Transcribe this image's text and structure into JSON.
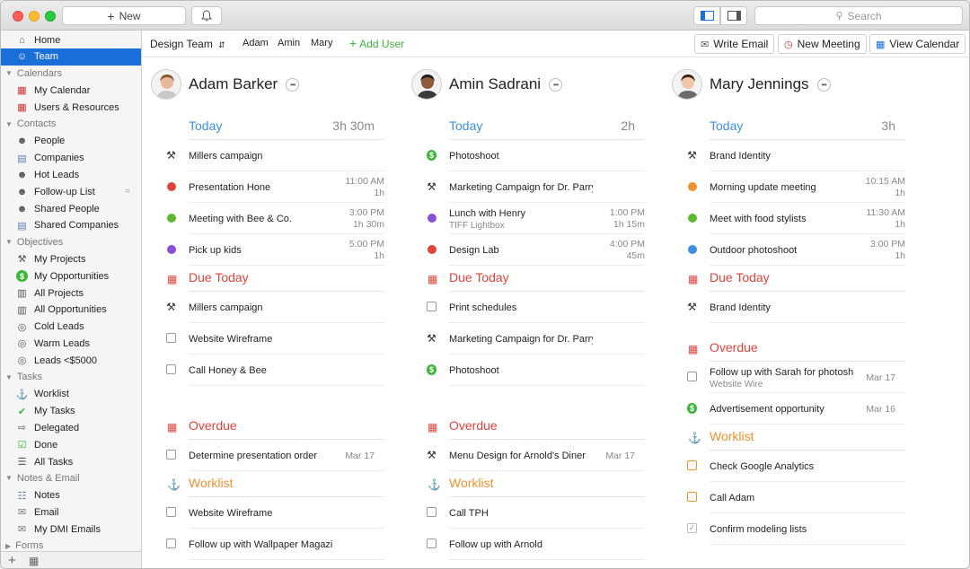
{
  "toolbar": {
    "new_label": "New",
    "search_placeholder": "Search"
  },
  "sidebar": {
    "top": [
      {
        "label": "Home",
        "icon": "home-icon"
      },
      {
        "label": "Team",
        "icon": "team-icon",
        "selected": true
      }
    ],
    "groups": [
      {
        "label": "Calendars",
        "items": [
          {
            "label": "My Calendar",
            "icon": "calendar-icon"
          },
          {
            "label": "Users & Resources",
            "icon": "calendar-icon"
          }
        ]
      },
      {
        "label": "Contacts",
        "items": [
          {
            "label": "People",
            "icon": "person-icon"
          },
          {
            "label": "Companies",
            "icon": "building-icon"
          },
          {
            "label": "Hot Leads",
            "icon": "lead-icon"
          },
          {
            "label": "Follow-up List",
            "icon": "lead-icon"
          },
          {
            "label": "Shared People",
            "icon": "person-icon"
          },
          {
            "label": "Shared Companies",
            "icon": "building-icon"
          }
        ]
      },
      {
        "label": "Objectives",
        "items": [
          {
            "label": "My Projects",
            "icon": "hammer-icon"
          },
          {
            "label": "My Opportunities",
            "icon": "dollar-icon"
          },
          {
            "label": "All Projects",
            "icon": "binder-icon"
          },
          {
            "label": "All Opportunities",
            "icon": "binder-icon"
          },
          {
            "label": "Cold Leads",
            "icon": "coin-icon"
          },
          {
            "label": "Warm Leads",
            "icon": "coin-icon"
          },
          {
            "label": "Leads <$5000",
            "icon": "coin-icon"
          }
        ]
      },
      {
        "label": "Tasks",
        "items": [
          {
            "label": "Worklist",
            "icon": "pin-icon"
          },
          {
            "label": "My Tasks",
            "icon": "check-icon"
          },
          {
            "label": "Delegated",
            "icon": "arrow-icon"
          },
          {
            "label": "Done",
            "icon": "checkbox-icon"
          },
          {
            "label": "All Tasks",
            "icon": "list-icon"
          }
        ]
      },
      {
        "label": "Notes & Email",
        "items": [
          {
            "label": "Notes",
            "icon": "notes-icon"
          },
          {
            "label": "Email",
            "icon": "email-icon"
          },
          {
            "label": "My DMI Emails",
            "icon": "email-icon"
          }
        ]
      },
      {
        "label": "Forms",
        "items": []
      }
    ]
  },
  "team_bar": {
    "team_name": "Design Team",
    "members": [
      "Adam",
      "Amin",
      "Mary"
    ],
    "add_user": "Add User",
    "write_email": "Write Email",
    "new_meeting": "New Meeting",
    "view_calendar": "View Calendar"
  },
  "colors": {
    "accent_blue": "#1a6fd8",
    "today_blue": "#3d8fe0",
    "due_red": "#e0433c",
    "worklist_orange": "#f0912f",
    "add_green": "#3db53d"
  },
  "people": [
    {
      "name": "Adam Barker",
      "today": {
        "label": "Today",
        "duration": "3h 30m",
        "items": [
          {
            "icon": "hammer",
            "title": "Millers campaign"
          },
          {
            "icon": "dot",
            "color": "#e0433c",
            "title": "Presentation Hone",
            "time": "11:00 AM",
            "dur": "1h"
          },
          {
            "icon": "dot",
            "color": "#5cb82e",
            "title": "Meeting with Bee & Co.",
            "time": "3:00 PM",
            "dur": "1h 30m"
          },
          {
            "icon": "dot",
            "color": "#8a4fd6",
            "title": "Pick up kids",
            "time": "5:00 PM",
            "dur": "1h"
          }
        ]
      },
      "due": {
        "label": "Due Today",
        "items": [
          {
            "icon": "hammer",
            "title": "Millers campaign"
          },
          {
            "icon": "check",
            "title": "Website Wireframe"
          },
          {
            "icon": "check",
            "title": "Call Honey & Bee"
          }
        ]
      },
      "overdue": {
        "label": "Overdue",
        "items": [
          {
            "icon": "check",
            "title": "Determine presentation order",
            "date": "Mar 17"
          }
        ]
      },
      "worklist": {
        "label": "Worklist",
        "items": [
          {
            "icon": "check",
            "title": "Website Wireframe"
          },
          {
            "icon": "check",
            "title": "Follow up with Wallpaper Magazine"
          }
        ]
      }
    },
    {
      "name": "Amin Sadrani",
      "today": {
        "label": "Today",
        "duration": "2h",
        "items": [
          {
            "icon": "dollar",
            "title": "Photoshoot"
          },
          {
            "icon": "hammer",
            "title": "Marketing Campaign for Dr. Parry Kenum"
          },
          {
            "icon": "dot",
            "color": "#8a4fd6",
            "title": "Lunch with Henry",
            "sub": "TIFF Lightbox",
            "time": "1:00 PM",
            "dur": "1h 15m"
          },
          {
            "icon": "dot",
            "color": "#e0433c",
            "title": "Design Lab",
            "time": "4:00 PM",
            "dur": "45m"
          }
        ]
      },
      "due": {
        "label": "Due Today",
        "items": [
          {
            "icon": "check",
            "title": "Print schedules"
          },
          {
            "icon": "hammer",
            "title": "Marketing Campaign for Dr. Parry Kenum"
          },
          {
            "icon": "dollar",
            "title": "Photoshoot"
          }
        ]
      },
      "overdue": {
        "label": "Overdue",
        "items": [
          {
            "icon": "hammer",
            "title": "Menu Design for Arnold's Diner",
            "date": "Mar 17"
          }
        ]
      },
      "worklist": {
        "label": "Worklist",
        "items": [
          {
            "icon": "check",
            "title": "Call TPH"
          },
          {
            "icon": "check",
            "title": "Follow up with Arnold"
          }
        ]
      }
    },
    {
      "name": "Mary Jennings",
      "today": {
        "label": "Today",
        "duration": "3h",
        "items": [
          {
            "icon": "hammer",
            "title": "Brand Identity"
          },
          {
            "icon": "dot",
            "color": "#f0912f",
            "title": "Morning update meeting",
            "time": "10:15 AM",
            "dur": "1h"
          },
          {
            "icon": "dot",
            "color": "#5cb82e",
            "title": "Meet with food stylists",
            "time": "11:30 AM",
            "dur": "1h"
          },
          {
            "icon": "dot",
            "color": "#3d8fe0",
            "title": "Outdoor photoshoot",
            "time": "3:00 PM",
            "dur": "1h"
          }
        ]
      },
      "due": {
        "label": "Due Today",
        "items": [
          {
            "icon": "hammer",
            "title": "Brand Identity"
          }
        ]
      },
      "overdue": {
        "label": "Overdue",
        "items": [
          {
            "icon": "check",
            "title": "Follow up with Sarah for photosh...",
            "sub": "Website Wire",
            "date": "Mar 17"
          },
          {
            "icon": "dollar",
            "title": "Advertisement opportunity",
            "date": "Mar 16"
          }
        ]
      },
      "worklist": {
        "label": "Worklist",
        "items": [
          {
            "icon": "check-orange",
            "title": "Check Google Analytics"
          },
          {
            "icon": "check-orange",
            "title": "Call Adam"
          },
          {
            "icon": "check-done",
            "title": "Confirm modeling lists"
          }
        ]
      }
    }
  ]
}
